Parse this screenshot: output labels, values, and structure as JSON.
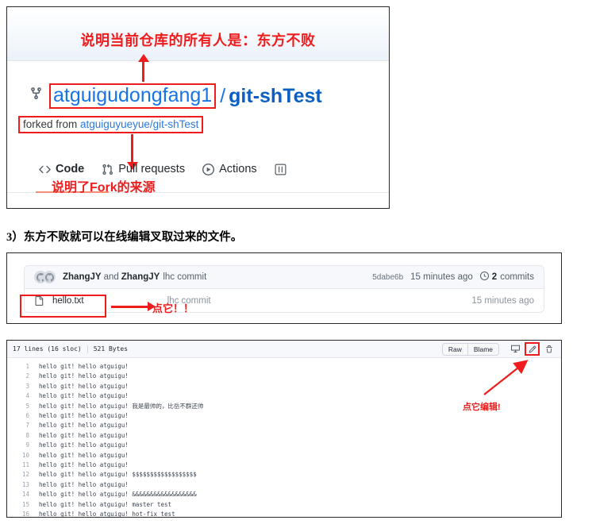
{
  "panel1": {
    "annotation_top": "说明当前仓库的所有人是：东方不败",
    "fork_icon": "fork-icon",
    "repo_owner": "atguigudongfang1",
    "repo_slash": "/",
    "repo_name": "git-shTest",
    "forked_from_label": "forked from ",
    "forked_from_link": "atguiguyueyue/git-shTest",
    "annotation_fork_source": "说明了Fork的来源",
    "nav": [
      {
        "label": "Code",
        "icon": "code-icon",
        "active": true
      },
      {
        "label": "Pull requests",
        "icon": "pull-request-icon",
        "active": false
      },
      {
        "label": "Actions",
        "icon": "play-circle-icon",
        "active": false
      },
      {
        "label": "",
        "icon": "projects-icon",
        "active": false
      }
    ]
  },
  "caption": "3）东方不败就可以在线编辑叉取过来的文件。",
  "panel2": {
    "commit": {
      "author_primary": "ZhangJY",
      "and_label": "and",
      "author_secondary": "ZhangJY",
      "message": "lhc commit",
      "sha": "5dabe6b",
      "time": "15 minutes ago",
      "commits_count": "2",
      "commits_label": "commits",
      "history_icon": "clock-history-icon"
    },
    "file": {
      "icon": "file-icon",
      "name": "hello.txt",
      "message": "lhc commit",
      "time": "15 minutes ago"
    },
    "annotation_click_it": "点它！！"
  },
  "panel3": {
    "blob_meta_lines": "17 lines (16 sloc)",
    "blob_meta_size": "521 Bytes",
    "toolbar": {
      "raw_label": "Raw",
      "blame_label": "Blame",
      "display_icon": "display-icon",
      "edit_icon": "pencil-edit-icon",
      "delete_icon": "trash-icon"
    },
    "annotation_click_edit": "点它编辑!",
    "code_lines": [
      {
        "n": "1",
        "text": "hello git! hello atguigu!"
      },
      {
        "n": "2",
        "text": "hello git! hello atguigu!"
      },
      {
        "n": "3",
        "text": "hello git! hello atguigu!"
      },
      {
        "n": "4",
        "text": "hello git! hello atguigu!"
      },
      {
        "n": "5",
        "text": "hello git! hello atguigu! 我是最帅的，比岳不群还帅"
      },
      {
        "n": "6",
        "text": "hello git! hello atguigu!"
      },
      {
        "n": "7",
        "text": "hello git! hello atguigu!"
      },
      {
        "n": "8",
        "text": "hello git! hello atguigu!"
      },
      {
        "n": "9",
        "text": "hello git! hello atguigu!"
      },
      {
        "n": "10",
        "text": "hello git! hello atguigu!"
      },
      {
        "n": "11",
        "text": "hello git! hello atguigu!"
      },
      {
        "n": "12",
        "text": "hello git! hello atguigu! $$$$$$$$$$$$$$$$$$"
      },
      {
        "n": "13",
        "text": "hello git! hello atguigu!"
      },
      {
        "n": "14",
        "text": "hello git! hello atguigu! &&&&&&&&&&&&&&&&&&"
      },
      {
        "n": "15",
        "text": "hello git! hello atguigu! master test"
      },
      {
        "n": "16",
        "text": "hello git! hello atguigu! hot-fix test"
      }
    ]
  },
  "colors": {
    "annotation_red": "#ee1c1c",
    "link_blue": "#1774e6",
    "repo_name_blue": "#0a5fc4"
  }
}
